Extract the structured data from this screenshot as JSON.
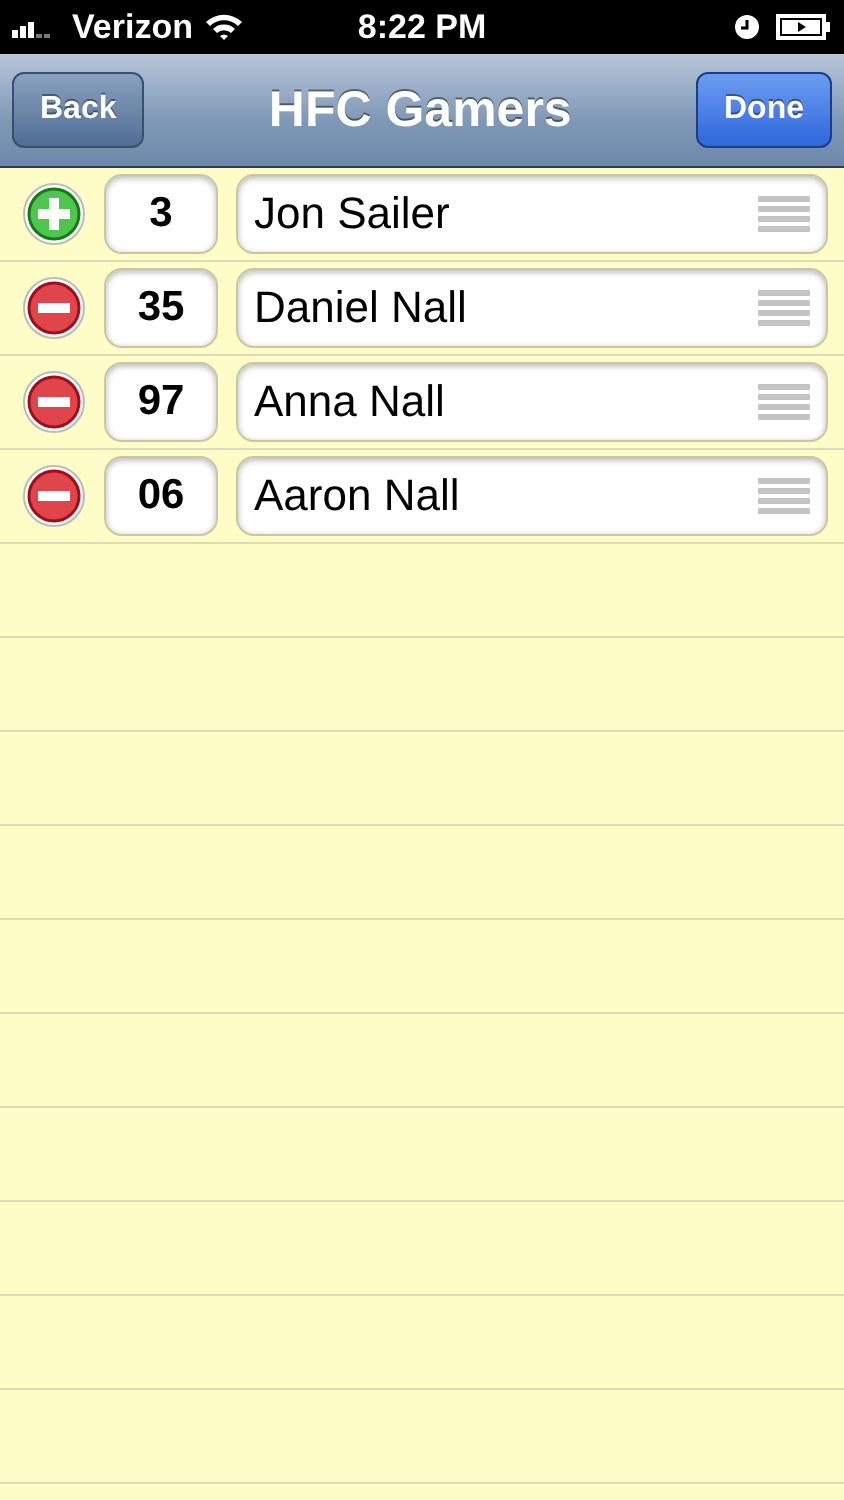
{
  "status_bar": {
    "carrier": "Verizon",
    "time": "8:22 PM"
  },
  "nav_bar": {
    "title": "HFC Gamers",
    "back_button": "Back",
    "done_button": "Done"
  },
  "players": [
    {
      "kind": "add",
      "number": "3",
      "name": "Jon Sailer"
    },
    {
      "kind": "remove",
      "number": "35",
      "name": "Daniel Nall"
    },
    {
      "kind": "remove",
      "number": "97",
      "name": "Anna Nall"
    },
    {
      "kind": "remove",
      "number": "06",
      "name": "Aaron Nall"
    }
  ]
}
